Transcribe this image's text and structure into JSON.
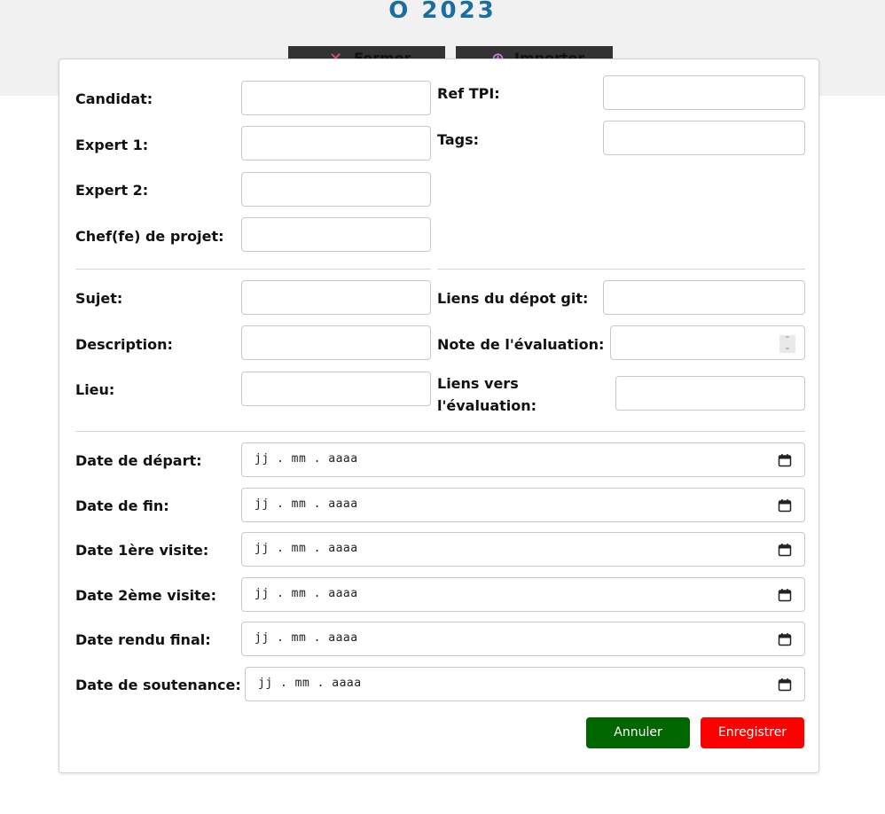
{
  "header": {
    "title": "O 2023",
    "close_button": {
      "label": "Fermer",
      "icon": "close-icon"
    },
    "import_button": {
      "label": "Importer",
      "icon": "import-icon"
    }
  },
  "form": {
    "candidat": {
      "label": "Candidat:",
      "value": ""
    },
    "expert1": {
      "label": "Expert 1:",
      "value": ""
    },
    "expert2": {
      "label": "Expert 2:",
      "value": ""
    },
    "chef_projet": {
      "label": "Chef(fe) de projet:",
      "value": ""
    },
    "ref_tpi": {
      "label": "Ref TPI:",
      "value": ""
    },
    "tags": {
      "label": "Tags:",
      "value": ""
    },
    "sujet": {
      "label": "Sujet:",
      "value": ""
    },
    "description": {
      "label": "Description:",
      "value": ""
    },
    "lieu": {
      "label": "Lieu:",
      "value": ""
    },
    "liens_git": {
      "label": "Liens du dépot git:",
      "value": ""
    },
    "note_evaluation": {
      "label": "Note de l'évaluation:",
      "value": ""
    },
    "liens_evaluation": {
      "label_line1": "Liens vers",
      "label_line2": "l'évaluation:",
      "value": ""
    },
    "date_depart": {
      "label": "Date de départ:",
      "placeholder": "jj . mm . aaaa"
    },
    "date_fin": {
      "label": "Date de fin:",
      "placeholder": "jj . mm . aaaa"
    },
    "date_visite1": {
      "label": "Date 1ère visite:",
      "placeholder": "jj . mm . aaaa"
    },
    "date_visite2": {
      "label": "Date 2ème visite:",
      "placeholder": "jj . mm . aaaa"
    },
    "date_rendu": {
      "label": "Date rendu final:",
      "placeholder": "jj . mm . aaaa"
    },
    "date_soutenance": {
      "label": "Date de soutenance:",
      "placeholder": "jj . mm . aaaa"
    }
  },
  "actions": {
    "cancel": {
      "label": "Annuler",
      "color": "#006600"
    },
    "save": {
      "label": "Enregistrer",
      "color": "#ff0000"
    }
  },
  "colors": {
    "title": "#1a6fa0",
    "background_band": "#f1f1f1",
    "header_buttons": "#333333"
  }
}
